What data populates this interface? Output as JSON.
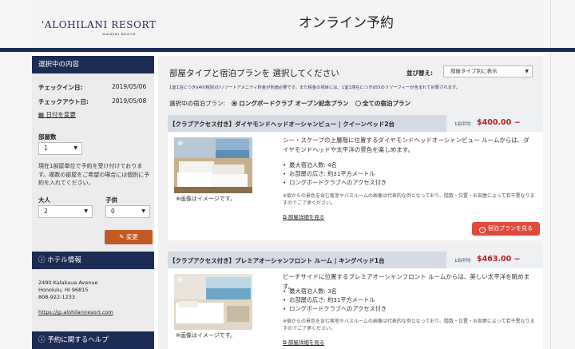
{
  "header": {
    "logo": "'ALOHILANI RESORT",
    "logo_sub": "WAIKIKI BEACH",
    "title": "オンライン予約"
  },
  "sidebar": {
    "selection_title": "選択中の内容",
    "checkin_label": "チェックイン日:",
    "checkin_value": "2019/05/06",
    "checkout_label": "チェックアウト日:",
    "checkout_value": "2019/05/08",
    "change_date_link": "日付を変更",
    "rooms_label": "部屋数",
    "rooms_value": "1",
    "note": "現在1部屋単位で予約を受け付けております。複数の部屋をご希望の場合には個別に予約を入れてください。",
    "adults_label": "大人",
    "adults_value": "2",
    "children_label": "子供",
    "children_value": "0",
    "change_button": "変更",
    "hotel_info_title": "ホテル情報",
    "address_line1": "2490 Kalakaua Avenue",
    "address_line2": "Honolulu, HI 96815",
    "phone": "808-922-1233",
    "website": "https://jp.alohilaniresort.com",
    "help_title": "予約に関するヘルプ"
  },
  "main": {
    "title": "部屋タイプと宿泊プランを 選択してください",
    "sort_label": "並び替え:",
    "sort_value": "部屋タイプ別に表示",
    "info_line": "1室1泊につき$40(税別)のリゾートアメニティ料金が別途必要です。また税金の項目には、1室1滞在につき$55のリゾーフィーが含まれて計算されます。",
    "plan_label": "選択中の宿泊プラン:",
    "plan_option_1": "ロングボードクラブ オープン記念プラン",
    "plan_option_2": "全ての宿泊プラン"
  },
  "rooms": [
    {
      "name": "【クラブアクセス付き】ダイヤモンドヘッドオーシャンビュー | クイーンベッド2台",
      "price_label": "1泊平均",
      "price": "$400.00 ~",
      "caption": "※画像はイメージです。",
      "description": "シー・スケープの上層階に位置するダイヤモンドヘッドオーシャンビュー ルームからは、ダイヤモンドヘッドや太平洋の景色を楽しめます。",
      "features": [
        "最大宿泊人数: 4名",
        "お部屋の広さ: 約31平方メートル",
        "ロングボードクラブへのアクセス付き"
      ],
      "fine_print": "※宿からの景色を含む客室やバスルームの画像は代表的な例となっており、階数・位置・お部屋によって若干異なりますのでご了承ください。",
      "detail_link": "部屋詳細を見る",
      "plan_button": "宿泊プランを見る"
    },
    {
      "name": "【クラブアクセス付き】プレミアオーシャンフロント ルーム | キングベッド1台",
      "price_label": "1泊平均",
      "price": "$463.00 ~",
      "caption": "※画像はイメージです。",
      "description": "ビーチサイドに位置するプレミアオーシャンフロント ルームからは、美しい太平洋を眺めます。",
      "features": [
        "最大宿泊人数: 3名",
        "お部屋の広さ: 約31平方メートル",
        "ロングボードクラブへのアクセス付き"
      ],
      "fine_print": "※宿からの景色を含む客室やバスルームの画像は代表的な例となっており、階数・位置・お部屋によって若干異なりますのでご了承ください。",
      "detail_link": "部屋詳細を見る"
    }
  ]
}
